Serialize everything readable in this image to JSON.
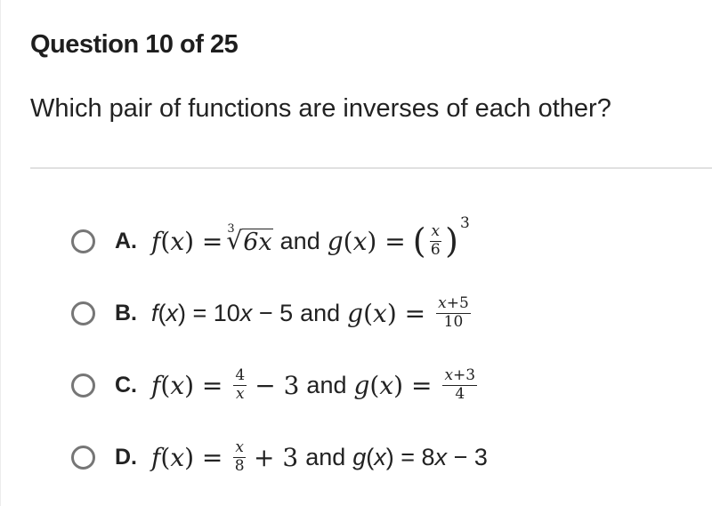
{
  "header": {
    "title": "Question 10 of 25",
    "prompt": "Which pair of functions are inverses of each other?"
  },
  "options": [
    {
      "letter": "A.",
      "f_lhs": "f(x) =",
      "f_root_index": "3",
      "f_radicand": "6x",
      "connector": "and",
      "g_lhs": "g(x) =",
      "g_frac_num": "x",
      "g_frac_den": "6",
      "g_exponent": "3",
      "selected": false
    },
    {
      "letter": "B.",
      "f_text": "f(x) = 10x − 5",
      "connector": "and",
      "g_lhs": "g(x) =",
      "g_frac_num": "x+5",
      "g_frac_den": "10",
      "selected": false
    },
    {
      "letter": "C.",
      "f_lhs": "f(x) =",
      "f_frac_num": "4",
      "f_frac_den": "x",
      "f_tail": "− 3",
      "connector": "and",
      "g_lhs": "g(x) =",
      "g_frac_num": "x+3",
      "g_frac_den": "4",
      "selected": false
    },
    {
      "letter": "D.",
      "f_lhs": "f(x) =",
      "f_frac_num": "x",
      "f_frac_den": "8",
      "f_tail": "+ 3",
      "connector": "and",
      "g_text": "g(x) = 8x − 3",
      "selected": false
    }
  ],
  "colors": {
    "text": "#222222",
    "radio_border": "#767676",
    "divider": "#e0e0e0",
    "background": "#ffffff"
  }
}
